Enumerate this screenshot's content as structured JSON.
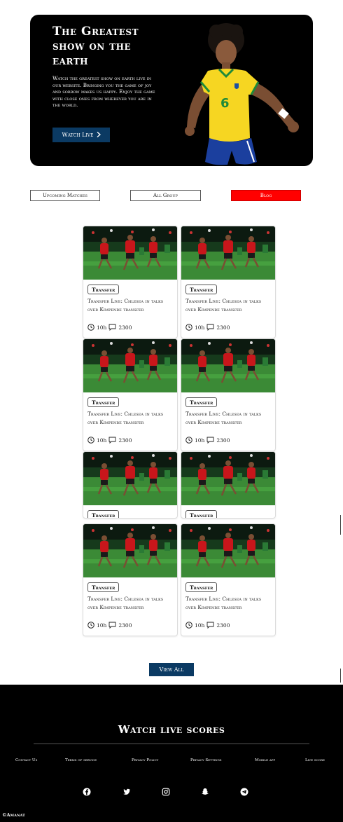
{
  "hero": {
    "title": "The Greatest show on the earth",
    "text": "Watch the greatest show on earth live in our website. Bringing you the game of joy and sorrow makes us happy. Enjoy the game with close ones from wherever you are in the world.",
    "button_label": "Watch Live",
    "button_icon": "chevron-right-icon",
    "jersey_number": "6"
  },
  "tabs": [
    {
      "label": "Upcoming Matches",
      "active": false
    },
    {
      "label": "All Group",
      "active": false
    },
    {
      "label": "Blog",
      "active": true,
      "color": "#ff0000"
    }
  ],
  "cards": [
    {
      "badge": "Transfer",
      "title_line1": "Transfer Live: Chlesea in talks",
      "title_line2": "over Kimpenbe transfer",
      "time": "10h",
      "comments": "2300"
    },
    {
      "badge": "Transfer",
      "title_line1": "Transfer Live: Chlesea in talks",
      "title_line2": "over Kimpenbe transfer",
      "time": "10h",
      "comments": "2300"
    },
    {
      "badge": "Transfer",
      "title_line1": "Transfer Live: Chlesea in talks",
      "title_line2": "over Kimpenbe transfer",
      "time": "10h",
      "comments": "2300"
    },
    {
      "badge": "Transfer",
      "title_line1": "Transfer Live: Chlesea in talks",
      "title_line2": "over Kimpenbe transfer",
      "time": "10h",
      "comments": "2300"
    },
    {
      "badge": "Transfer"
    },
    {
      "badge": "Transfer"
    },
    {
      "badge": "Transfer",
      "title_line1": "Transfer Live: Chlesea in talks",
      "title_line2": "over Kimpenbe transfer",
      "time": "10h",
      "comments": "2300"
    },
    {
      "badge": "Transfer",
      "title_line1": "Transfer Live: Chlesea in talks",
      "title_line2": "over Kimpenbe transfer",
      "time": "10h",
      "comments": "2300"
    }
  ],
  "view_all_label": "View All",
  "footer": {
    "title": "Watch live scores",
    "links": [
      "Contact Us",
      "Terms of service",
      "Privacy Policy",
      "Privacy Settings",
      "Mobile app",
      "Live score"
    ],
    "social_icons": [
      "facebook-icon",
      "twitter-icon",
      "instagram-icon",
      "snapchat-icon",
      "telegram-icon"
    ],
    "copyright": "©Amanat"
  },
  "colors": {
    "accent_blue": "#0b3a63",
    "blog_red": "#ff0000",
    "footer_bg": "#000000"
  }
}
